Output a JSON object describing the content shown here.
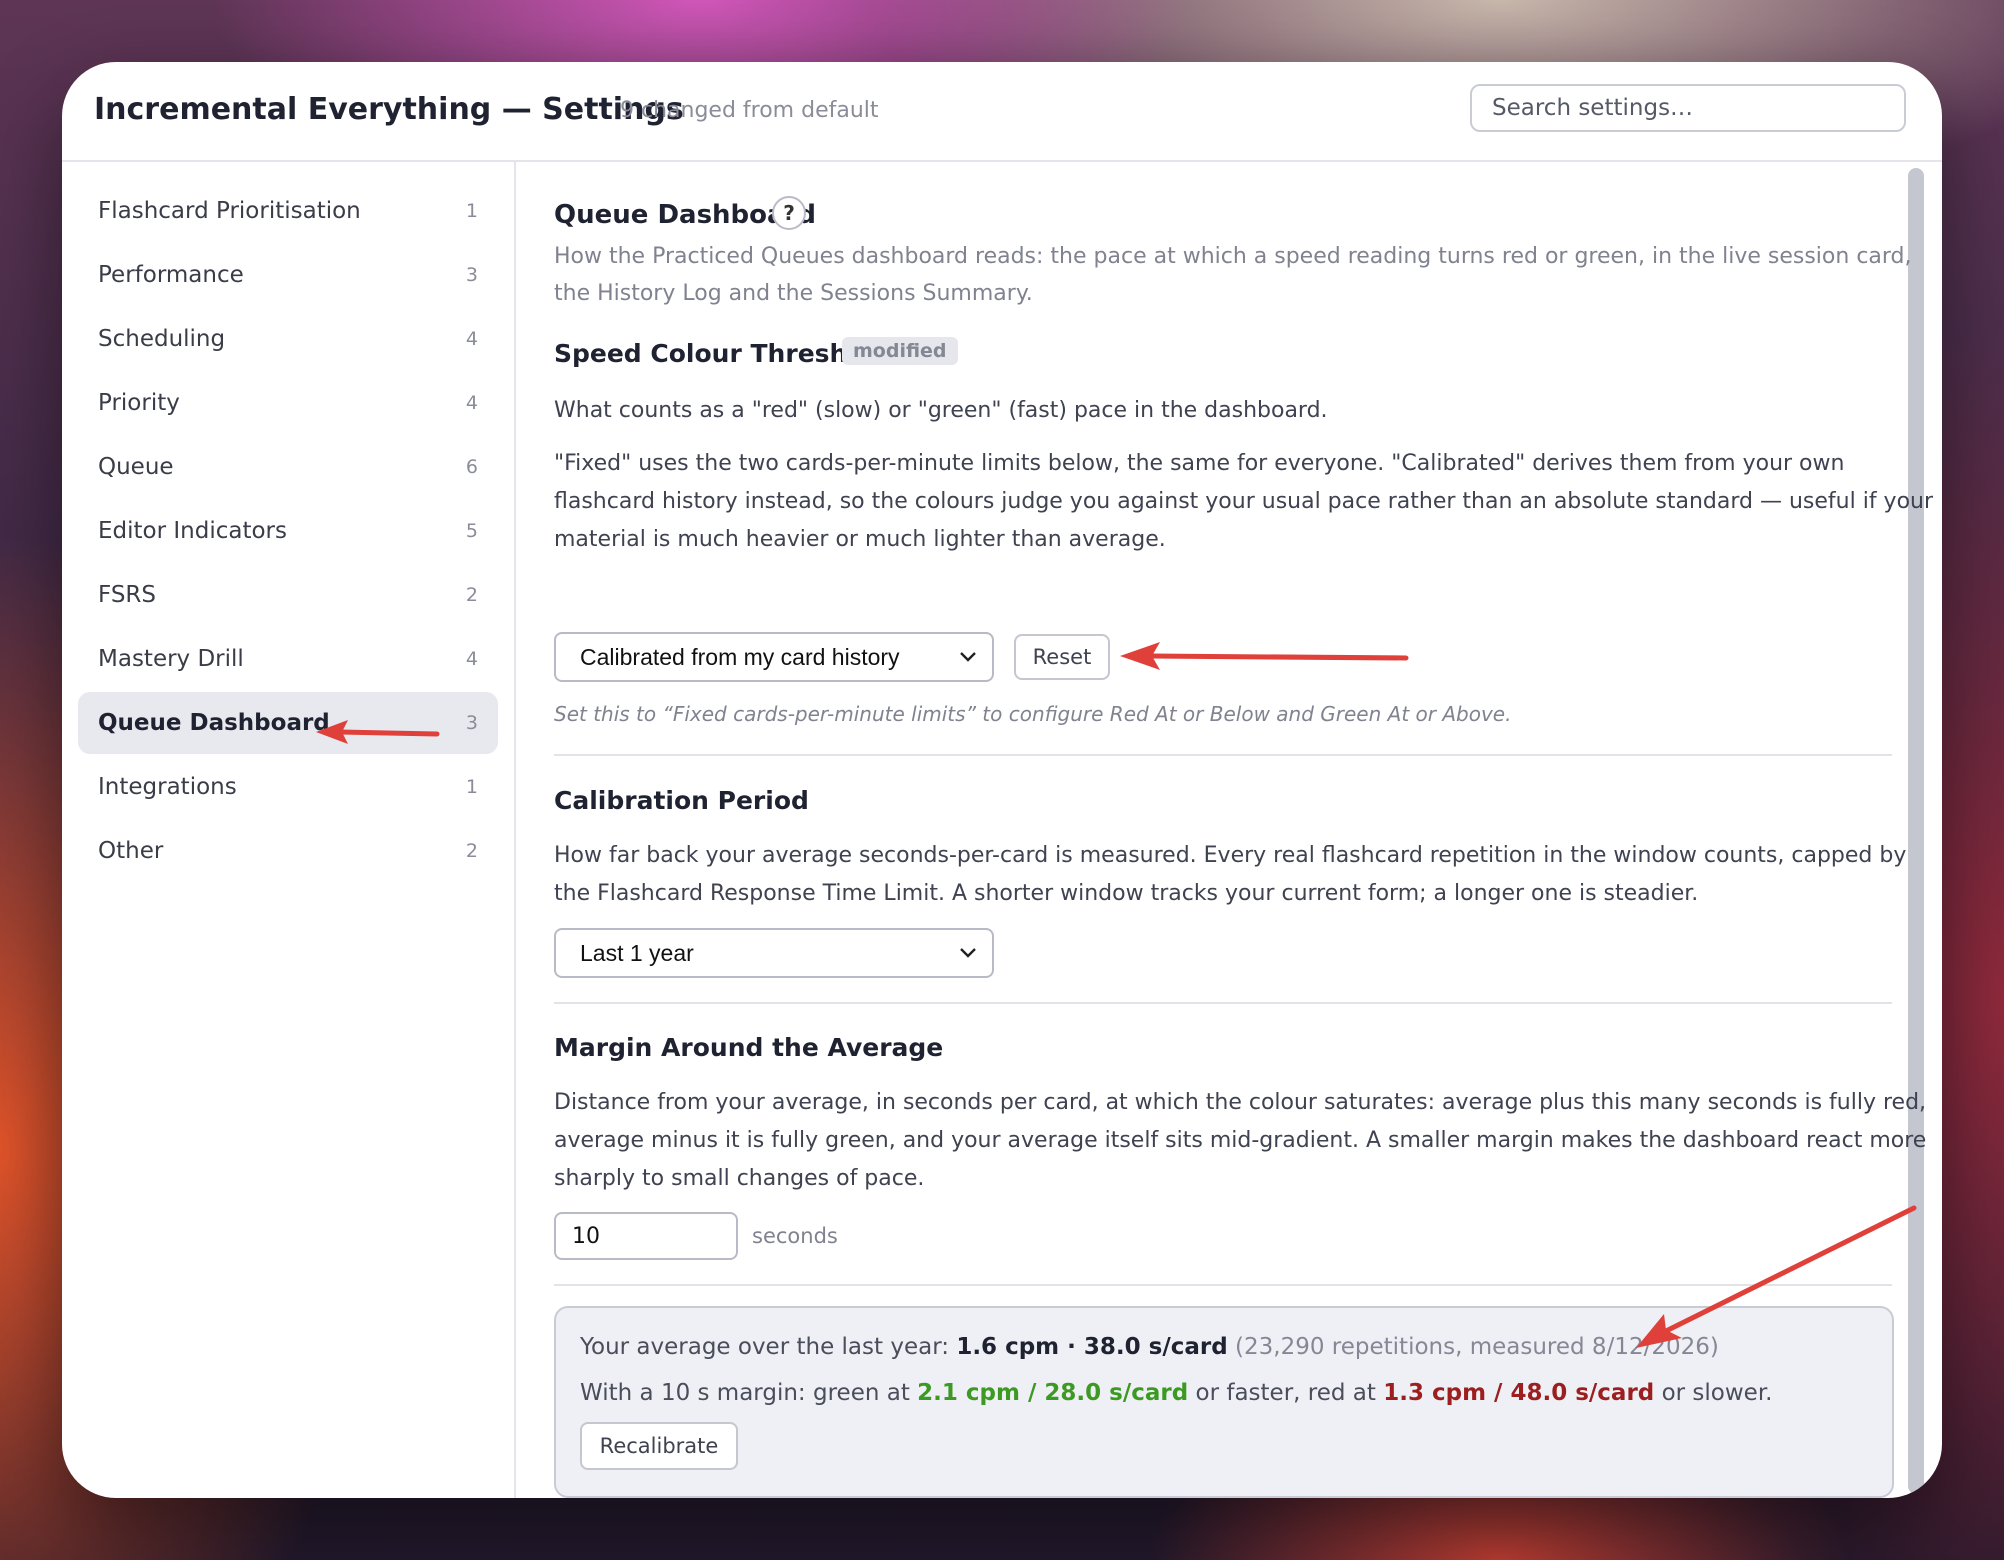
{
  "header": {
    "title": "Incremental Everything — Settings",
    "changed_note": "9 changed from default",
    "search_placeholder": "Search settings…"
  },
  "sidebar": {
    "items": [
      {
        "label": "Flashcard Prioritisation",
        "count": "1"
      },
      {
        "label": "Performance",
        "count": "3"
      },
      {
        "label": "Scheduling",
        "count": "4"
      },
      {
        "label": "Priority",
        "count": "4"
      },
      {
        "label": "Queue",
        "count": "6"
      },
      {
        "label": "Editor Indicators",
        "count": "5"
      },
      {
        "label": "FSRS",
        "count": "2"
      },
      {
        "label": "Mastery Drill",
        "count": "4"
      },
      {
        "label": "Queue Dashboard",
        "count": "3",
        "active": true
      },
      {
        "label": "Integrations",
        "count": "1"
      },
      {
        "label": "Other",
        "count": "2"
      }
    ]
  },
  "section": {
    "title": "Queue Dashboard",
    "help_label": "?",
    "description": "How the Practiced Queues dashboard reads: the pace at which a speed reading turns red or green, in the live session card, the History Log and the Sessions Summary."
  },
  "speed_thresholds": {
    "title": "Speed Colour Thresholds",
    "badge": "modified",
    "description_1": "What counts as a \"red\" (slow) or \"green\" (fast) pace in the dashboard.",
    "description_2": "\"Fixed\" uses the two cards-per-minute limits below, the same for everyone. \"Calibrated\" derives them from your own flashcard history instead, so the colours judge you against your usual pace rather than an absolute standard — useful if your material is much heavier or much lighter than average.",
    "selected": "Calibrated from my card history",
    "reset_label": "Reset",
    "hint": "Set this to “Fixed cards-per-minute limits” to configure Red At or Below and Green At or Above."
  },
  "calibration_period": {
    "title": "Calibration Period",
    "description": "How far back your average seconds-per-card is measured. Every real flashcard repetition in the window counts, capped by the Flashcard Response Time Limit. A shorter window tracks your current form; a longer one is steadier.",
    "selected": "Last 1 year"
  },
  "margin": {
    "title": "Margin Around the Average",
    "description": "Distance from your average, in seconds per card, at which the colour saturates: average plus this many seconds is fully red, average minus it is fully green, and your average itself sits mid-gradient. A smaller margin makes the dashboard react more sharply to small changes of pace.",
    "value": "10",
    "unit": "seconds"
  },
  "calibration_summary": {
    "line1_prefix": "Your average over the last year: ",
    "cpm": "1.6 cpm",
    "sep": " · ",
    "spc": "38.0 s/card",
    "detail": " (23,290 repetitions, measured 8/12/2026)",
    "line2_prefix": "With a 10 s margin: green at ",
    "green_value": "2.1 cpm / 28.0 s/card",
    "line2_mid": " or faster, red at ",
    "red_value": "1.3 cpm / 48.0 s/card",
    "line2_suffix": " or slower.",
    "recalibrate_label": "Recalibrate"
  },
  "colors": {
    "accent_green": "#3c9a22",
    "accent_red": "#9c1f1f",
    "annotation_arrow": "#e0403a"
  }
}
